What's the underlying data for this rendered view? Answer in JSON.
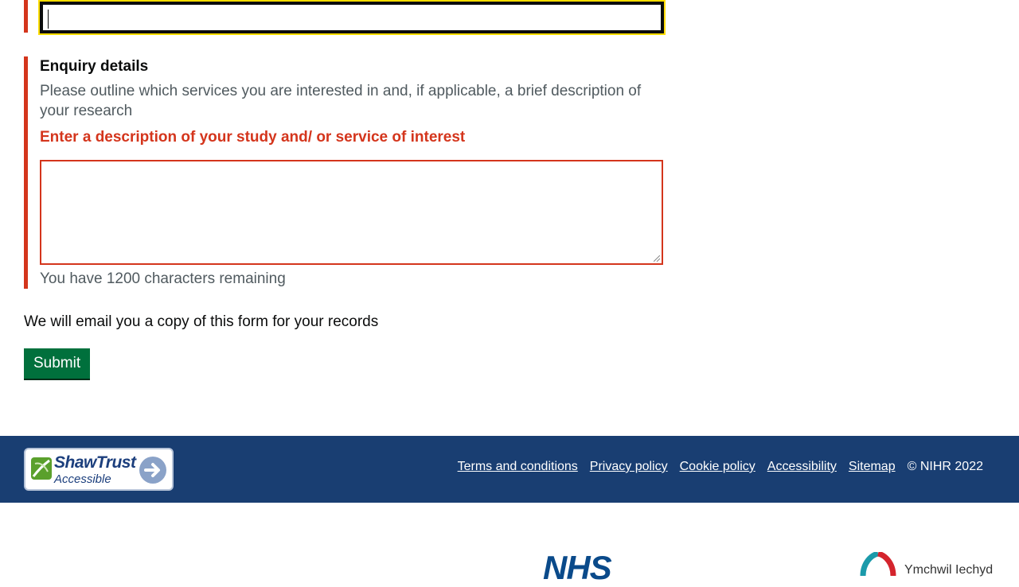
{
  "form": {
    "enquiry_label": "Enquiry details",
    "enquiry_hint": "Please outline which services you are interested in and, if applicable, a brief description of your research",
    "error_message": "Enter a description of your study and/ or service of interest",
    "char_counter": "You have 1200 characters remaining",
    "email_note": "We will email you a copy of this form for your records",
    "submit_label": "Submit"
  },
  "footer": {
    "badge_name": "ShawTrust",
    "badge_sub": "Accessible",
    "links": [
      "Terms and conditions",
      "Privacy policy",
      "Cookie policy",
      "Accessibility",
      "Sitemap"
    ],
    "copyright": "© NIHR 2022"
  },
  "logos": {
    "nhs": "NHS",
    "hcrw": "Ymchwil Iechyd"
  },
  "colors": {
    "error": "#d4351c",
    "focus": "#ffdd00",
    "submit": "#00703c",
    "footer_bg": "#193e72"
  }
}
